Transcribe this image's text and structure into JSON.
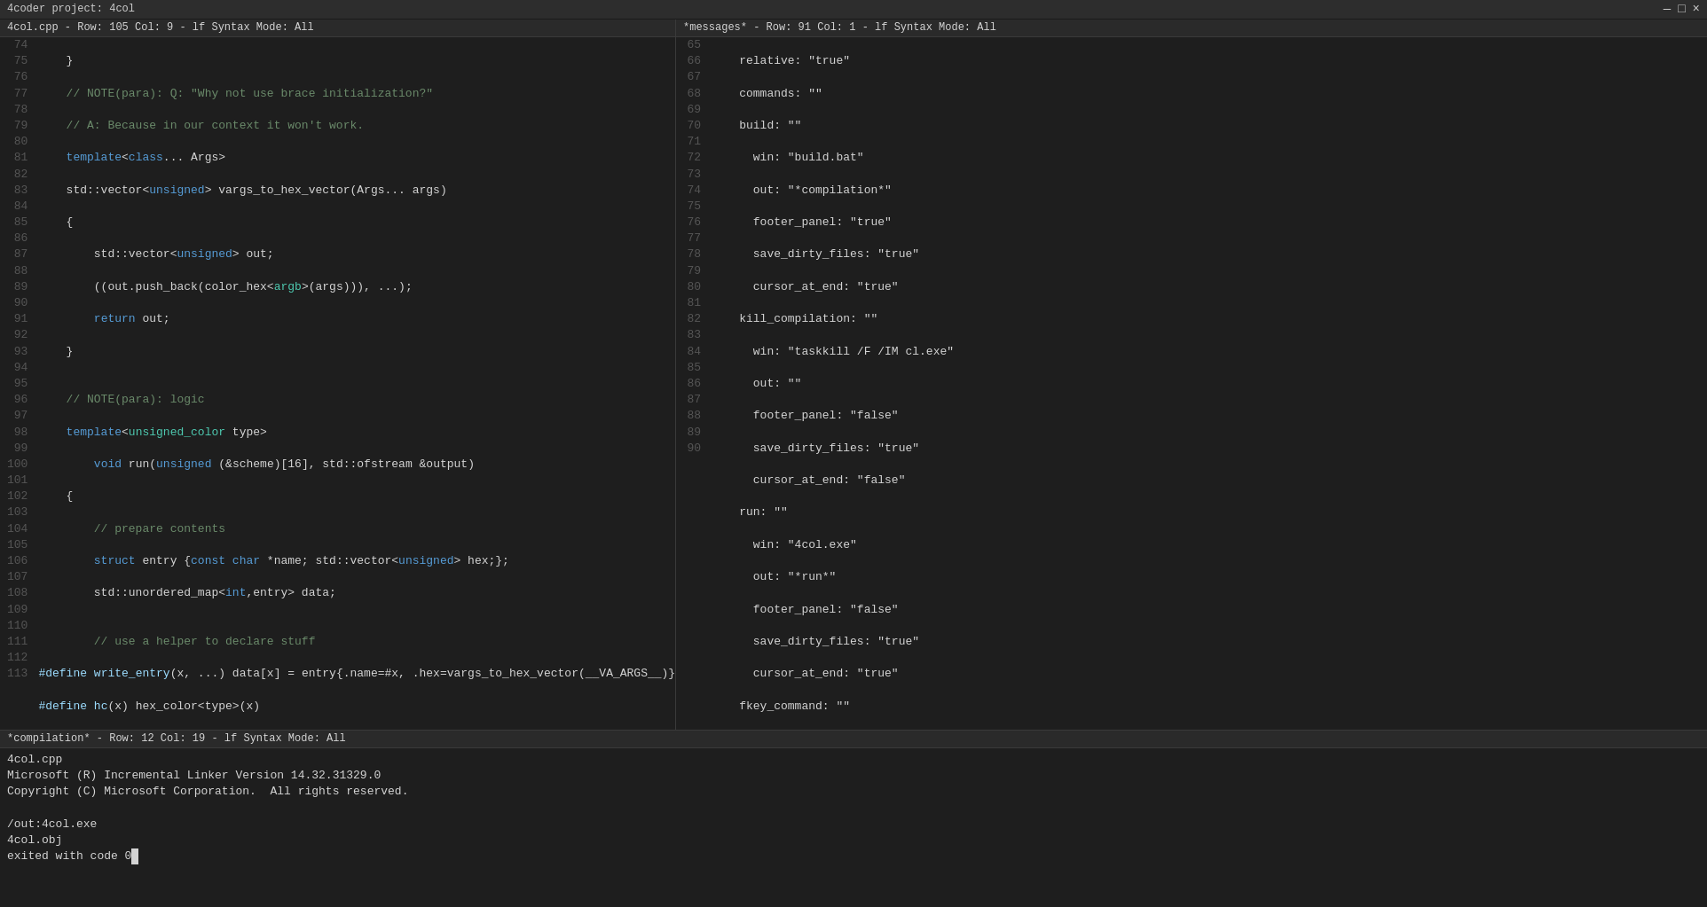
{
  "title": "4coder project: 4col",
  "left_header": "4col.cpp - Row: 105 Col:   9 - lf  Syntax Mode: All",
  "right_header": "*messages* - Row:  91 Col:   1 - lf  Syntax Mode: All",
  "bottom_header": "*compilation* - Row:  12 Col:  19 - lf  Syntax Mode: All",
  "title_controls": [
    "—",
    "□",
    "×"
  ],
  "compilation_lines": [
    "4col.cpp",
    "Microsoft (R) Incremental Linker Version 14.32.31329.0",
    "Copyright (C) Microsoft Corporation.  All rights reserved.",
    "",
    "/out:4col.exe",
    "4col.obj",
    "exited with code 0"
  ]
}
